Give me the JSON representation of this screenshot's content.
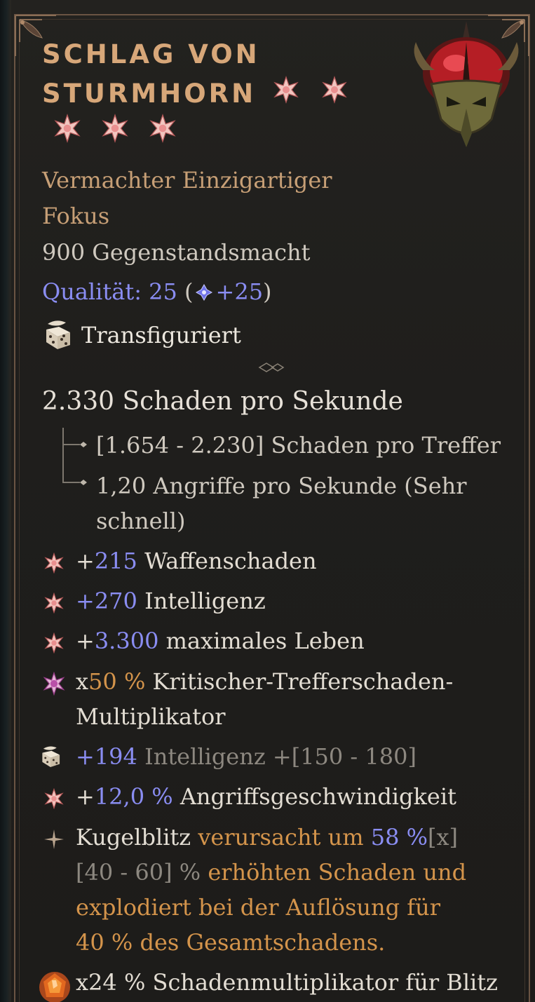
{
  "item": {
    "name_line1": "SCHLAG VON",
    "name_line2": "STURMHORN",
    "rarity_line1": "Vermachter Einzigartiger",
    "rarity_line2": "Fokus",
    "item_power": "900 Gegenstandsmacht",
    "quality_label": "Qualität: 25",
    "quality_open": " (",
    "quality_bonus": "+25",
    "quality_close": ")",
    "transfigured": "Transfiguriert"
  },
  "damage": {
    "dps": "2.330 Schaden pro Sekunde",
    "per_hit": "[1.654 - 2.230] Schaden pro Treffer",
    "aps_line1": "1,20 Angriffe pro Sekunde (Sehr",
    "aps_line2": "schnell)"
  },
  "affixes": [
    {
      "prefix": "+",
      "value": "215",
      "text": " Waffenschaden"
    },
    {
      "prefix": "",
      "value": "+270",
      "text": " Intelligenz"
    },
    {
      "prefix": "+",
      "value": "3.300",
      "text": " maximales Leben"
    },
    {
      "prefix": "x",
      "value": "50 %",
      "text_line1": " Kritischer-Trefferschaden-",
      "text_line2": "Multiplikator"
    },
    {
      "prefix": "",
      "value": "+194",
      "text": " Intelligenz +[150 - 180]"
    },
    {
      "prefix": "+",
      "value": "12,0 %",
      "text": " Angriffsgeschwindigkeit"
    }
  ],
  "unique_power": {
    "skill": "Kugelblitz",
    "t1": " verursacht um ",
    "value": "58 %",
    "range1": "[x]",
    "range2": "[40 - 60] %",
    "t2": " erhöhten Schaden und",
    "t3": "explodiert bei der Auflösung für",
    "t4": "40 % des Gesamtschadens."
  },
  "bottom_line": "x24 % Schadenmultiplikator für Blitz",
  "colors": {
    "title": "#d7a779",
    "rarity": "#c79f76",
    "value_blue": "#8a8df2",
    "unique_orange": "#d4944b"
  },
  "icons": [
    "gem-star-icon",
    "helm-icon",
    "dice-icon",
    "sparkle-icon",
    "fire-gem-icon"
  ]
}
